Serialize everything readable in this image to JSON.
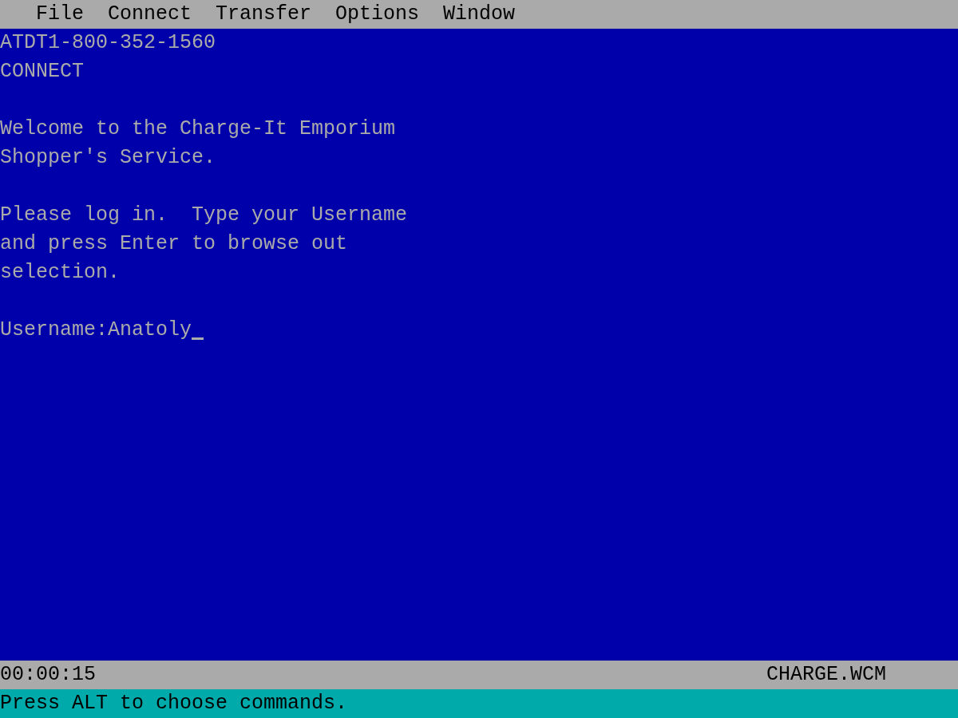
{
  "menu_bar": [
    {
      "label": "File"
    },
    {
      "label": "Connect"
    },
    {
      "label": "Transfer"
    },
    {
      "label": "Options"
    },
    {
      "label": "Window"
    }
  ],
  "terminal": {
    "paragraphs": [
      [
        "ATDT1-800-352-1560",
        "CONNECT"
      ],
      [
        "Welcome to the Charge-It Emporium",
        "Shopper's Service."
      ],
      [
        "Please log in.  Type your Username",
        "and press Enter to browse out",
        "selection."
      ]
    ],
    "prompt": {
      "label": "Username:",
      "value": "Anatoly",
      "cursor": true
    }
  },
  "status_bar": {
    "elapsed": "00:00:15",
    "file": "CHARGE.WCM"
  },
  "help_line": "Press ALT to choose commands."
}
